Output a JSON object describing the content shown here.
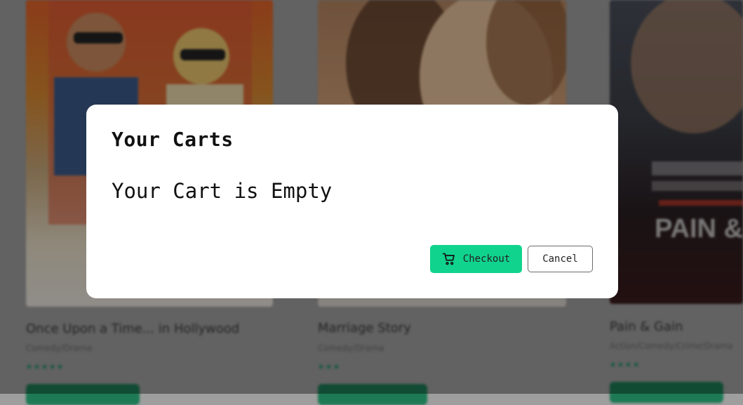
{
  "background": {
    "movies": [
      {
        "title": "Once Upon a Time... in Hollywood",
        "genre": "Comedy/Drama",
        "stars": "★★★★★"
      },
      {
        "title": "Marriage Story",
        "genre": "Comedy/Drama",
        "stars": "★★★"
      },
      {
        "title": "Pain & Gain",
        "genre": "Action/Comedy/Crime/Drama",
        "stars": "★★★★"
      }
    ]
  },
  "modal": {
    "title": "Your Carts",
    "message": "Your Cart is Empty",
    "checkout_label": "Checkout",
    "cancel_label": "Cancel",
    "checkout_icon": "cart-icon",
    "accent_color": "#10d38e"
  }
}
